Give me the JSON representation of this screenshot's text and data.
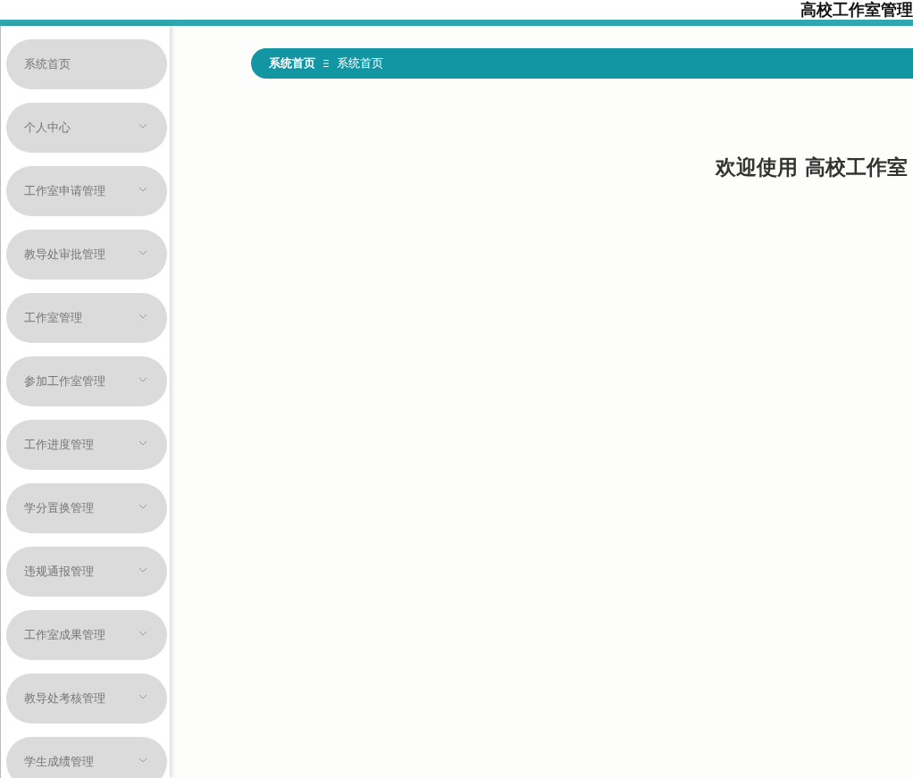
{
  "header": {
    "title": "高校工作室管理"
  },
  "sidebar": {
    "items": [
      {
        "label": "系统首页",
        "kind": "link"
      },
      {
        "label": "个人中心",
        "kind": "submenu"
      },
      {
        "label": "工作室申请管理",
        "kind": "submenu"
      },
      {
        "label": "教导处审批管理",
        "kind": "submenu"
      },
      {
        "label": "工作室管理",
        "kind": "submenu"
      },
      {
        "label": "参加工作室管理",
        "kind": "submenu"
      },
      {
        "label": "工作进度管理",
        "kind": "submenu"
      },
      {
        "label": "学分置换管理",
        "kind": "submenu"
      },
      {
        "label": "违规通报管理",
        "kind": "submenu"
      },
      {
        "label": "工作室成果管理",
        "kind": "submenu"
      },
      {
        "label": "教导处考核管理",
        "kind": "submenu"
      },
      {
        "label": "学生成绩管理",
        "kind": "submenu"
      }
    ]
  },
  "breadcrumb": [
    {
      "label": "系统首页",
      "selected": true
    },
    {
      "label": "系统首页",
      "selected": false
    }
  ],
  "welcome": "欢迎使用 高校工作室"
}
